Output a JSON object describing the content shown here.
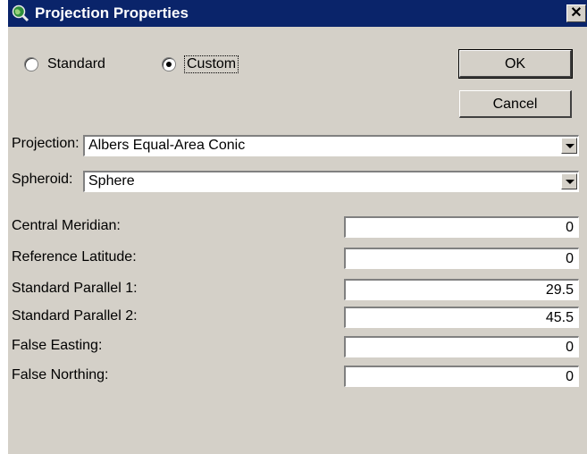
{
  "window": {
    "title": "Projection Properties",
    "close_glyph": "✕"
  },
  "mode": {
    "options": [
      {
        "label": "Standard",
        "checked": false
      },
      {
        "label": "Custom",
        "checked": true
      }
    ]
  },
  "buttons": {
    "ok": "OK",
    "cancel": "Cancel"
  },
  "projection": {
    "label": "Projection:",
    "value": "Albers Equal-Area Conic"
  },
  "spheroid": {
    "label": "Spheroid:",
    "value": "Sphere"
  },
  "parameters": [
    {
      "label": "Central Meridian:",
      "value": "0"
    },
    {
      "label": "Reference Latitude:",
      "value": "0"
    },
    {
      "label": "Standard Parallel 1:",
      "value": "29.5"
    },
    {
      "label": "Standard Parallel 2:",
      "value": "45.5"
    },
    {
      "label": "False Easting:",
      "value": "0"
    },
    {
      "label": "False Northing:",
      "value": "0"
    }
  ]
}
